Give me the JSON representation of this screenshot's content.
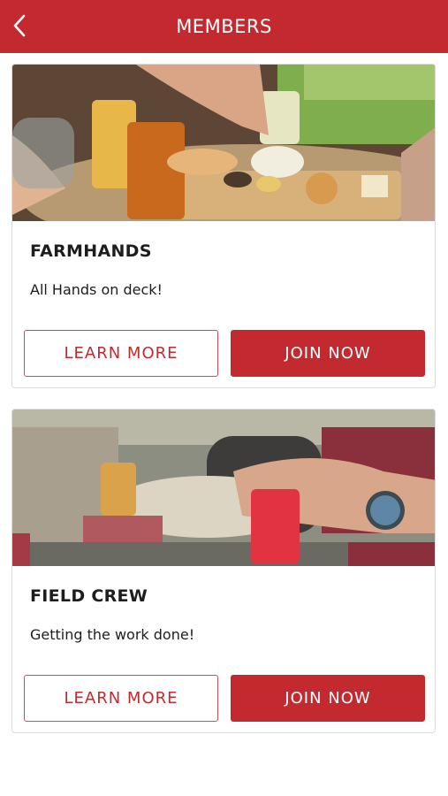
{
  "header": {
    "title": "MEMBERS",
    "back_icon": "chevron-left-icon",
    "color": "#c32a30"
  },
  "cards": [
    {
      "name": "FARMHANDS",
      "description": "All Hands on deck!",
      "learn_label": "LEARN MORE",
      "join_label": "JOIN NOW"
    },
    {
      "name": "FIELD CREW",
      "description": "Getting the work done!",
      "learn_label": "LEARN MORE",
      "join_label": "JOIN NOW"
    }
  ]
}
